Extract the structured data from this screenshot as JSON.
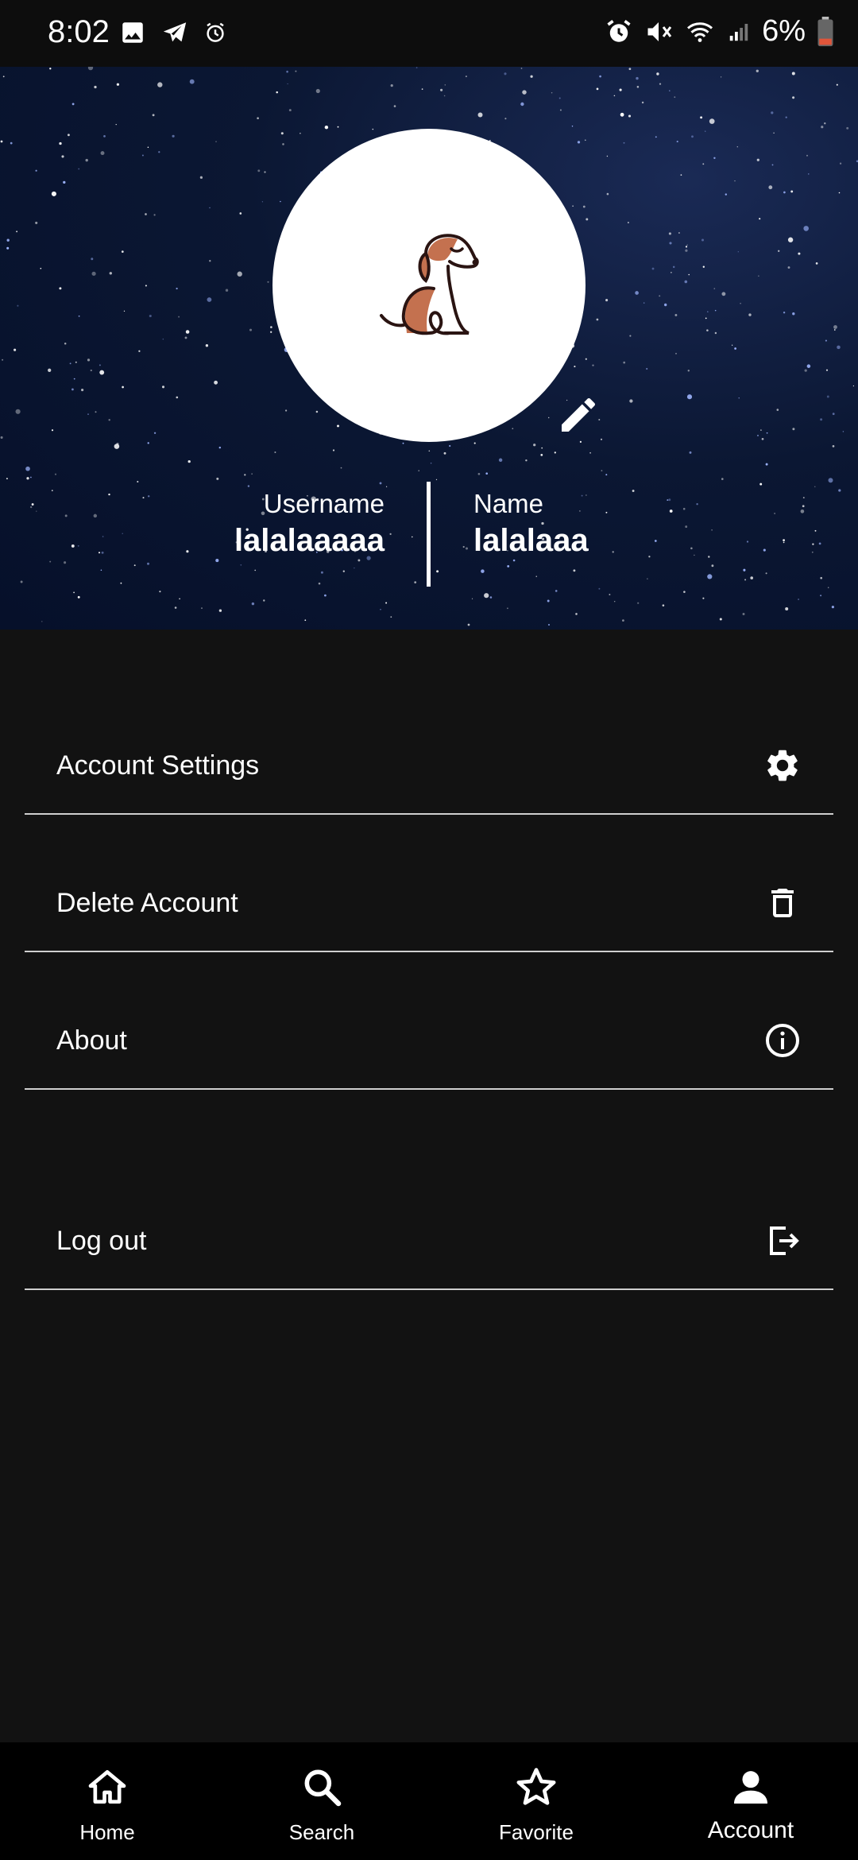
{
  "status_bar": {
    "time": "8:02",
    "battery": "6%",
    "left_icons": [
      "image-icon",
      "telegram-icon",
      "alarm-icon"
    ],
    "right_icons": [
      "alarm-icon",
      "mute-icon",
      "wifi-icon",
      "signal-icon",
      "battery-icon"
    ]
  },
  "profile": {
    "avatar": "dog-icon",
    "username_label": "Username",
    "username_value": "lalalaaaaa",
    "name_label": "Name",
    "name_value": "lalalaaa",
    "edit_icon": "pencil-icon"
  },
  "menu": {
    "items": [
      {
        "label": "Account Settings",
        "icon": "gear-icon"
      },
      {
        "label": "Delete Account",
        "icon": "trash-icon"
      },
      {
        "label": "About",
        "icon": "info-icon"
      },
      {
        "label": "Log out",
        "icon": "logout-icon"
      }
    ]
  },
  "bottom_nav": {
    "items": [
      {
        "label": "Home",
        "icon": "home-icon"
      },
      {
        "label": "Search",
        "icon": "search-icon"
      },
      {
        "label": "Favorite",
        "icon": "star-icon"
      },
      {
        "label": "Account",
        "icon": "account-icon"
      }
    ],
    "active": "Account"
  },
  "colors": {
    "background": "#121212",
    "header_sky": "#0b1733",
    "divider": "#cfcfcf",
    "nav_background": "#000000",
    "accent_dog": "#c4714f",
    "battery_low": "#e0553a"
  }
}
